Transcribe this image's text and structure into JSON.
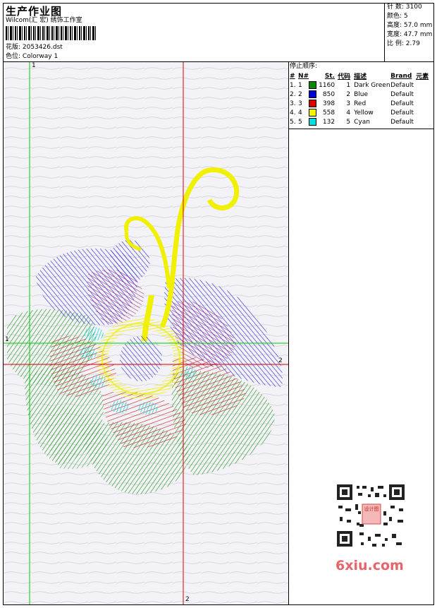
{
  "header": {
    "title": "生产作业图",
    "company": "Wilcom(汇 宏) 绣饰工作室",
    "file_label": "花版:",
    "file_name": "2053426.dst",
    "colorway_label": "色位:",
    "colorway_name": "Colorway 1"
  },
  "stats": [
    {
      "label": "针 数:",
      "value": "3100"
    },
    {
      "label": "颜色:",
      "value": "5"
    },
    {
      "label": "高度:",
      "value": "57.0 mm"
    },
    {
      "label": "宽度:",
      "value": "47.7 mm"
    },
    {
      "label": "比 例:",
      "value": "2.79"
    }
  ],
  "stop_sequence": {
    "title": "停止顺序:",
    "headers": [
      "#",
      "N#",
      "",
      "St.",
      "代码",
      "描述",
      "Brand",
      "元素"
    ],
    "rows": [
      {
        "num": "1.",
        "n": "1",
        "color": "#0a8a0a",
        "stitches": "1160",
        "code": "1",
        "desc": "Dark Green",
        "brand": "Default"
      },
      {
        "num": "2.",
        "n": "2",
        "color": "#0000d8",
        "stitches": "850",
        "code": "2",
        "desc": "Blue",
        "brand": "Default"
      },
      {
        "num": "3.",
        "n": "3",
        "color": "#d80000",
        "stitches": "398",
        "code": "3",
        "desc": "Red",
        "brand": "Default"
      },
      {
        "num": "4.",
        "n": "4",
        "color": "#f4f400",
        "stitches": "558",
        "code": "4",
        "desc": "Yellow",
        "brand": "Default"
      },
      {
        "num": "5.",
        "n": "5",
        "color": "#00e0e0",
        "stitches": "132",
        "code": "5",
        "desc": "Cyan",
        "brand": "Default"
      }
    ]
  },
  "canvas": {
    "axis_markers": [
      "1",
      "1",
      "2",
      "2"
    ]
  },
  "watermark": {
    "qr_stamp": "设计图",
    "logo": "6xiu.com"
  }
}
